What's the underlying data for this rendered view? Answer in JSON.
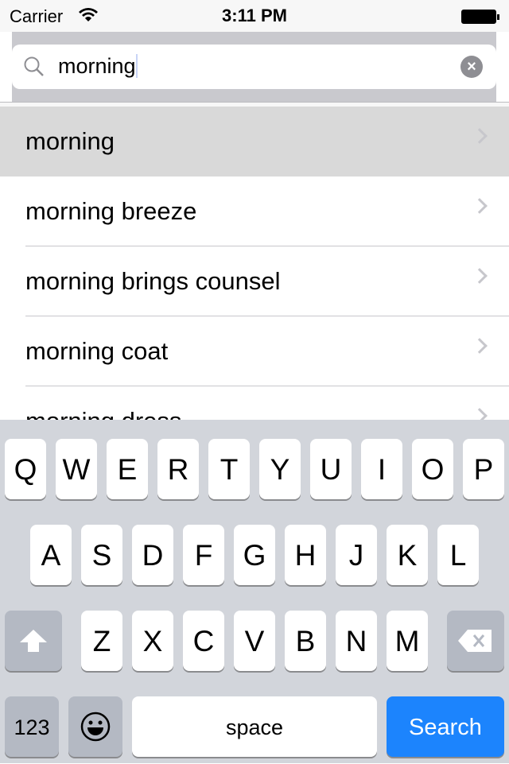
{
  "status_bar": {
    "carrier": "Carrier",
    "time": "3:11 PM"
  },
  "search": {
    "query": "morning",
    "clear_icon": "clear-icon",
    "search_icon": "magnifier-icon"
  },
  "suggestions": [
    {
      "label": "morning",
      "selected": true
    },
    {
      "label": "morning breeze"
    },
    {
      "label": "morning brings counsel"
    },
    {
      "label": "morning coat"
    },
    {
      "label": "morning dress"
    }
  ],
  "keyboard": {
    "row1": [
      "Q",
      "W",
      "E",
      "R",
      "T",
      "Y",
      "U",
      "I",
      "O",
      "P"
    ],
    "row2": [
      "A",
      "S",
      "D",
      "F",
      "G",
      "H",
      "J",
      "K",
      "L"
    ],
    "row3": [
      "Z",
      "X",
      "C",
      "V",
      "B",
      "N",
      "M"
    ],
    "numbers": "123",
    "space": "space",
    "search": "Search",
    "search_color": "#1c84fd"
  }
}
